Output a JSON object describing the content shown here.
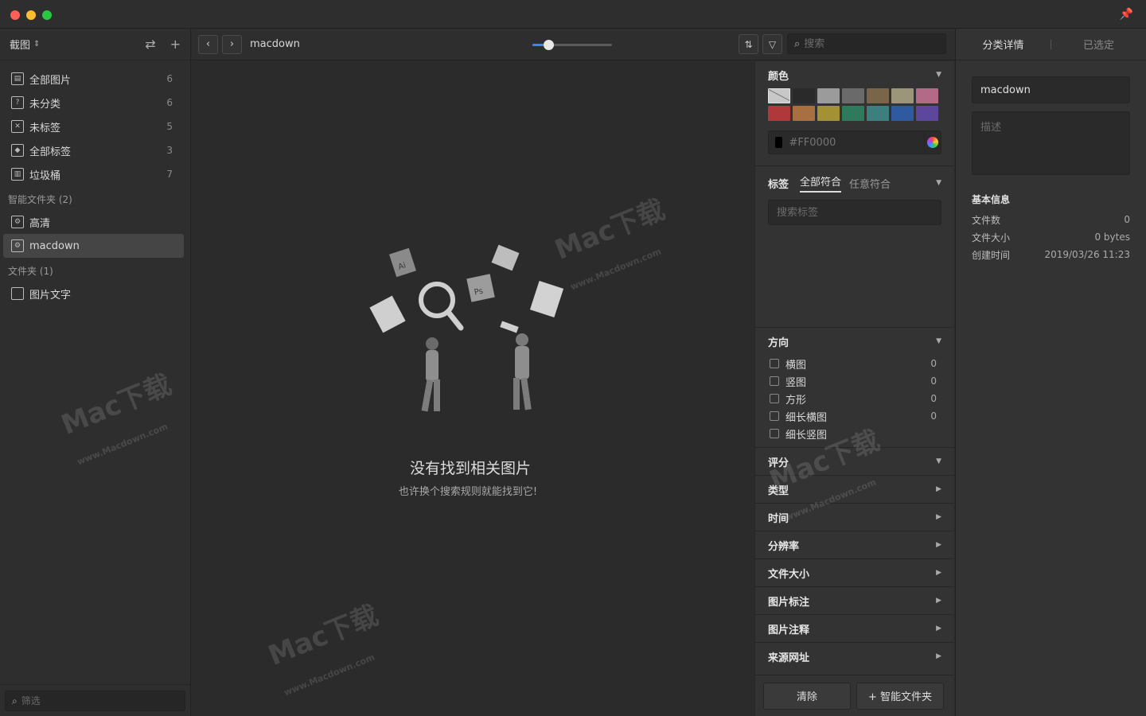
{
  "sidebar": {
    "title": "截图",
    "items": [
      {
        "label": "全部图片",
        "count": "6",
        "icon": "all-images-icon"
      },
      {
        "label": "未分类",
        "count": "6",
        "icon": "uncategorized-icon"
      },
      {
        "label": "未标签",
        "count": "5",
        "icon": "untagged-icon"
      },
      {
        "label": "全部标签",
        "count": "3",
        "icon": "all-tags-icon"
      },
      {
        "label": "垃圾桶",
        "count": "7",
        "icon": "trash-icon"
      }
    ],
    "smart_section": "智能文件夹 (2)",
    "smart_items": [
      {
        "label": "高清",
        "icon": "smart-folder-icon"
      },
      {
        "label": "macdown",
        "icon": "smart-folder-icon"
      }
    ],
    "folder_section": "文件夹 (1)",
    "folders": [
      {
        "label": "图片文字",
        "icon": "folder-icon"
      }
    ],
    "filter_placeholder": "筛选"
  },
  "toolbar": {
    "title": "macdown",
    "zoom_level": 0.2,
    "search_placeholder": "搜索"
  },
  "empty_state": {
    "title": "没有找到相关图片",
    "subtitle": "也许换个搜索规则就能找到它!"
  },
  "filters": {
    "color": {
      "title": "颜色",
      "swatches": [
        "none",
        "#2a2a2a",
        "#9b9b9b",
        "#6a6a6a",
        "#7a6549",
        "#9b9579",
        "#b36a86",
        "#b0383a",
        "#a87040",
        "#a39134",
        "#2f7a5c",
        "#3d7f7c",
        "#2f5aa0",
        "#5d479c"
      ],
      "hex_placeholder": "#FF0000"
    },
    "tags": {
      "title": "标签",
      "mode_all": "全部符合",
      "mode_any": "任意符合",
      "search_placeholder": "搜索标签"
    },
    "orientation": {
      "title": "方向",
      "options": [
        {
          "label": "横图",
          "count": "0"
        },
        {
          "label": "竖图",
          "count": "0"
        },
        {
          "label": "方形",
          "count": "0"
        },
        {
          "label": "细长横图",
          "count": "0"
        },
        {
          "label": "细长竖图",
          "count": ""
        }
      ]
    },
    "rating_title": "评分",
    "sections": [
      "类型",
      "时间",
      "分辨率",
      "文件大小",
      "图片标注",
      "图片注释",
      "来源网址"
    ],
    "clear_label": "清除",
    "smart_folder_label": "+ 智能文件夹"
  },
  "details": {
    "tab_details": "分类详情",
    "tab_selected": "已选定",
    "name_value": "macdown",
    "desc_placeholder": "描述",
    "info_title": "基本信息",
    "rows": [
      {
        "key": "文件数",
        "value": "0"
      },
      {
        "key": "文件大小",
        "value": "0 bytes"
      },
      {
        "key": "创建时间",
        "value": "2019/03/26 11:23"
      }
    ]
  },
  "watermark": {
    "brand": "Mac下载",
    "url": "www.Macdown.com"
  }
}
